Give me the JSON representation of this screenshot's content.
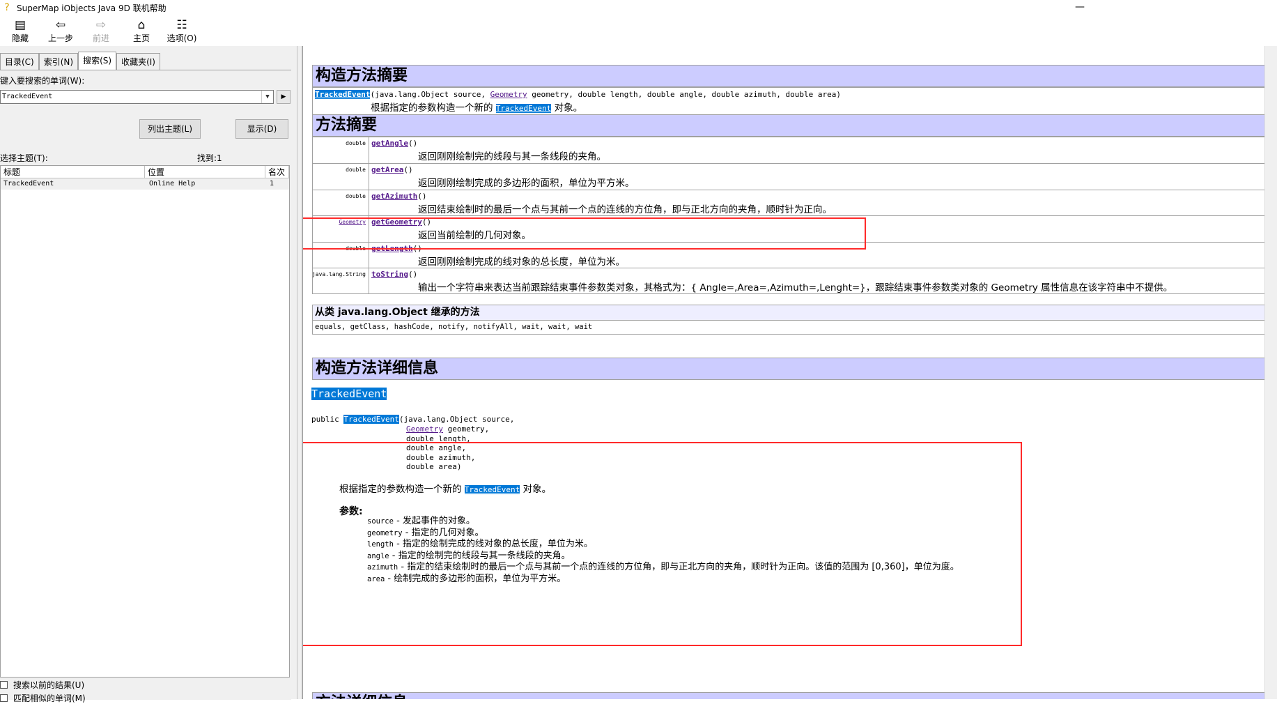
{
  "window": {
    "title": "SuperMap iObjects Java 9D 联机帮助",
    "minimize": "—"
  },
  "toolbar": {
    "hide": "隐藏",
    "back": "上一步",
    "forward": "前进",
    "home": "主页",
    "options": "选项(O)"
  },
  "tabs": {
    "contents": "目录(C)",
    "index": "索引(N)",
    "search": "搜索(S)",
    "favorites": "收藏夹(I)"
  },
  "search": {
    "prompt": "键入要搜索的单词(W):",
    "query": "TrackedEvent",
    "list_topics": "列出主题(L)",
    "display": "显示(D)",
    "select_topic": "选择主题(T):",
    "found": "找到:1",
    "columns": {
      "title": "标题",
      "location": "位置",
      "rank": "名次"
    },
    "results": [
      {
        "title": "TrackedEvent",
        "location": "Online Help",
        "rank": "1"
      }
    ],
    "search_previous": "搜索以前的结果(U)",
    "match_similar": "匹配相似的单词(M)"
  },
  "doc": {
    "constructor_summary": {
      "heading": "构造方法摘要",
      "sig_name": "TrackedEvent",
      "sig_p1": "(java.lang.Object source, ",
      "sig_geom": "Geometry",
      "sig_p2": " geometry, double length, double angle, double azimuth, double area)",
      "desc_a": "根据指定的参数构造一个新的 ",
      "desc_name": "TrackedEvent",
      "desc_b": " 对象。"
    },
    "method_summary": {
      "heading": "方法摘要",
      "rows": [
        {
          "type": "double",
          "name": "getAngle",
          "params": "()",
          "desc": "返回刚刚绘制完的线段与其一条线段的夹角。"
        },
        {
          "type": "double",
          "name": "getArea",
          "params": "()",
          "desc": "返回刚刚绘制完成的多边形的面积，单位为平方米。"
        },
        {
          "type": "double",
          "name": "getAzimuth",
          "params": "()",
          "desc": "返回结束绘制时的最后一个点与其前一个点的连线的方位角，即与正北方向的夹角，顺时针为正向。"
        },
        {
          "type": "Geometry",
          "name": "getGeometry",
          "params": "()",
          "desc": "返回当前绘制的几何对象。"
        },
        {
          "type": "double",
          "name": "getLength",
          "params": "()",
          "desc": "返回刚刚绘制完成的线对象的总长度，单位为米。"
        },
        {
          "type": "java.lang.String",
          "name": "toString",
          "params": "()",
          "desc": "输出一个字符串来表达当前跟踪结束事件参数类对象，其格式为：{ Angle=,Area=,Azimuth=,Lenght=}，跟踪结束事件参数类对象的 Geometry 属性信息在该字符串中不提供。"
        }
      ]
    },
    "inherited": {
      "heading": "从类 java.lang.Object 继承的方法",
      "methods": "equals, getClass, hashCode, notify, notifyAll, wait, wait, wait"
    },
    "constructor_detail": {
      "heading": "构造方法详细信息",
      "name": "TrackedEvent",
      "public": "public ",
      "sig_first": "(java.lang.Object source,",
      "sig_geom": "Geometry",
      "sig_geom_rest": " geometry,",
      "sig_lines": [
        "double length,",
        "double angle,",
        "double azimuth,",
        "double area)"
      ],
      "desc_a": "根据指定的参数构造一个新的 ",
      "desc_name": "TrackedEvent",
      "desc_b": " 对象。",
      "params_label": "参数:",
      "params": [
        {
          "name": "source",
          "desc": " - 发起事件的对象。"
        },
        {
          "name": "geometry",
          "desc": " - 指定的几何对象。"
        },
        {
          "name": "length",
          "desc": " - 指定的绘制完成的线对象的总长度，单位为米。"
        },
        {
          "name": "angle",
          "desc": " - 指定的绘制完的线段与其一条线段的夹角。"
        },
        {
          "name": "azimuth",
          "desc": " - 指定的结束绘制时的最后一个点与其前一个点的连线的方位角，即与正北方向的夹角，顺时针为正向。该值的范围为 [0,360]，单位为度。"
        },
        {
          "name": "area",
          "desc": " - 绘制完成的多边形的面积，单位为平方米。"
        }
      ]
    },
    "method_detail": {
      "heading": "方法详细信息"
    }
  },
  "colors": {
    "header_bg": "#ccccff",
    "highlight": "#0078d7",
    "annotation": "#ff2a2a",
    "link": "#551a8b"
  }
}
